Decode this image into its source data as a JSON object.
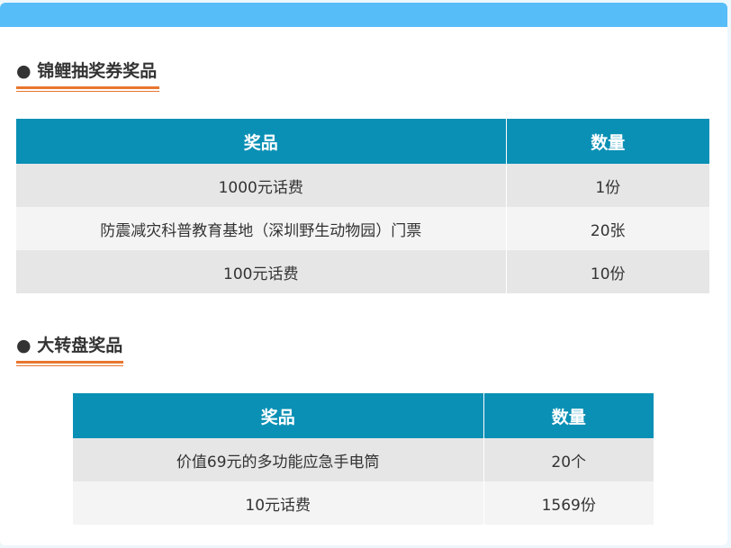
{
  "koi_section": {
    "title": "● 锦鲤抽奖券奖品",
    "header_prize": "奖品",
    "header_quantity": "数量",
    "rows": [
      {
        "prize": "1000元话费",
        "quantity": "1份"
      },
      {
        "prize": "防震减灾科普教育基地（深圳野生动物园）门票",
        "quantity": "20张"
      },
      {
        "prize": "100元话费",
        "quantity": "10份"
      }
    ]
  },
  "wheel_section": {
    "title": "● 大转盘奖品",
    "header_prize": "奖品",
    "header_quantity": "数量",
    "rows": [
      {
        "prize": "价值69元的多功能应急手电筒",
        "quantity": "20个"
      },
      {
        "prize": "10元话费",
        "quantity": "1569份"
      }
    ]
  },
  "colors": {
    "top_bar": "#57bdf8",
    "header_bg": "#0a90b5",
    "accent_underline": "#e8772e",
    "row_odd": "#e6e6e6",
    "row_even": "#f4f4f4"
  }
}
